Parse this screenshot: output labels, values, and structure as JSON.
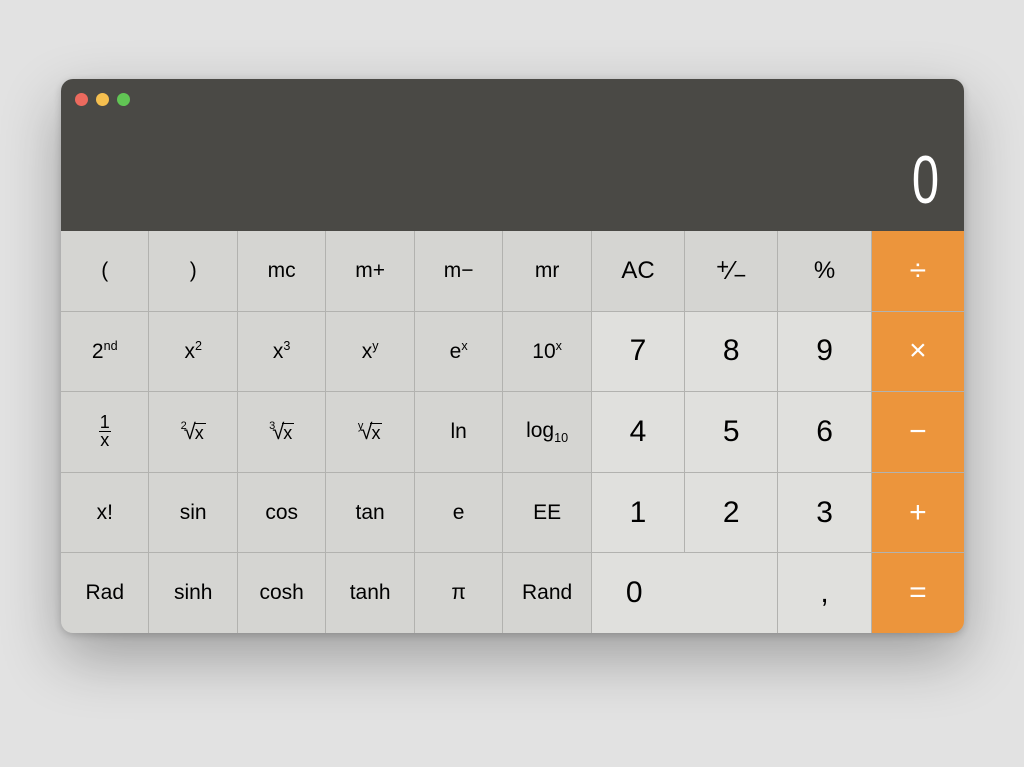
{
  "display": {
    "value": "0"
  },
  "colors": {
    "operator": "#ec953c",
    "sci": "#d5d5d2",
    "num": "#e0e0dd",
    "titlebar": "#4a4945"
  },
  "keys": {
    "lparen": "(",
    "rparen": ")",
    "mc": "mc",
    "mplus": "m+",
    "mminus": "m−",
    "mr": "mr",
    "ac": "AC",
    "plusminus_main": "+",
    "plusminus_sep": "⁄",
    "plusminus_sub": "−",
    "percent": "%",
    "divide": "÷",
    "second_base": "2",
    "second_sup": "nd",
    "x2_base": "x",
    "x2_sup": "2",
    "x3_base": "x",
    "x3_sup": "3",
    "xy_base": "x",
    "xy_sup": "y",
    "ex_base": "e",
    "ex_sup": "x",
    "tenx_base": "10",
    "tenx_sup": "x",
    "seven": "7",
    "eight": "8",
    "nine": "9",
    "multiply": "×",
    "inv_top": "1",
    "inv_bot": "x",
    "sqrt_idx": "2",
    "sqrt_arg": "x",
    "cbrt_idx": "3",
    "cbrt_arg": "x",
    "yroot_idx": "y",
    "yroot_arg": "x",
    "ln": "ln",
    "log10_base": "log",
    "log10_sub": "10",
    "four": "4",
    "five": "5",
    "six": "6",
    "minus": "−",
    "factorial": "x!",
    "sin": "sin",
    "cos": "cos",
    "tan": "tan",
    "e": "e",
    "ee": "EE",
    "one": "1",
    "two": "2",
    "three": "3",
    "plus": "+",
    "rad": "Rad",
    "sinh": "sinh",
    "cosh": "cosh",
    "tanh": "tanh",
    "pi": "π",
    "rand": "Rand",
    "zero": "0",
    "decimal": ",",
    "equals": "=",
    "radical": "√"
  }
}
